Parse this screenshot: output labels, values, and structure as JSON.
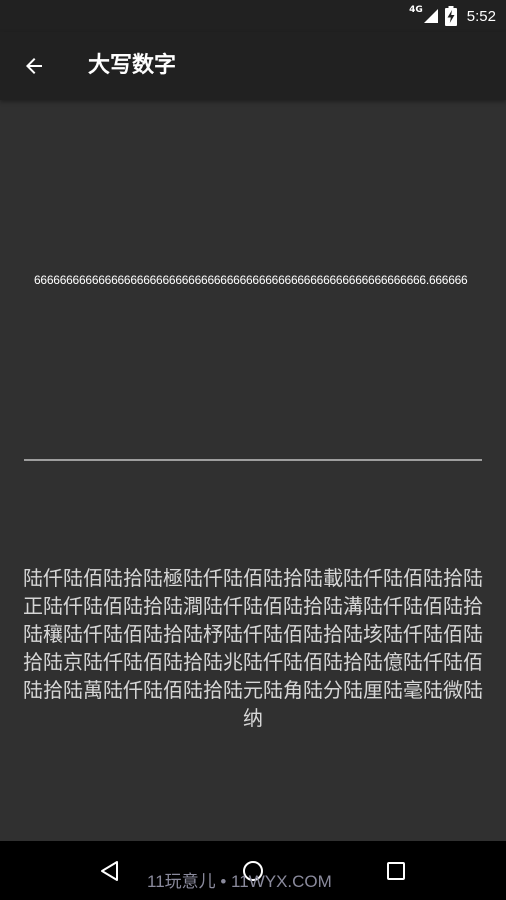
{
  "status_bar": {
    "network": "4G",
    "time": "5:52",
    "icons": [
      "signal-icon",
      "battery-charging-icon"
    ]
  },
  "app_bar": {
    "title": "大写数字",
    "back_icon": "arrow-left-icon"
  },
  "input": {
    "value": "6666666666666666666666666666666666666666666666666666666666666.666666"
  },
  "result": {
    "text": "陆仟陆佰陆拾陆極陆仟陆佰陆拾陆載陆仟陆佰陆拾陆正陆仟陆佰陆拾陆澗陆仟陆佰陆拾陆溝陆仟陆佰陆拾陆穰陆仟陆佰陆拾陆杼陆仟陆佰陆拾陆垓陆仟陆佰陆拾陆京陆仟陆佰陆拾陆兆陆仟陆佰陆拾陆億陆仟陆佰陆拾陆萬陆仟陆佰陆拾陆元陆角陆分陆厘陆毫陆微陆纳"
  },
  "nav_bar": {
    "icons": [
      "nav-back-icon",
      "nav-home-icon",
      "nav-recent-icon"
    ]
  },
  "watermark": {
    "text": "11玩意儿 • 11WYX.COM"
  },
  "colors": {
    "background": "#303030",
    "app_bar": "#212121",
    "nav_bar": "#000000",
    "underline": "#9e9e9e",
    "result_text": "#d6d6d6"
  }
}
